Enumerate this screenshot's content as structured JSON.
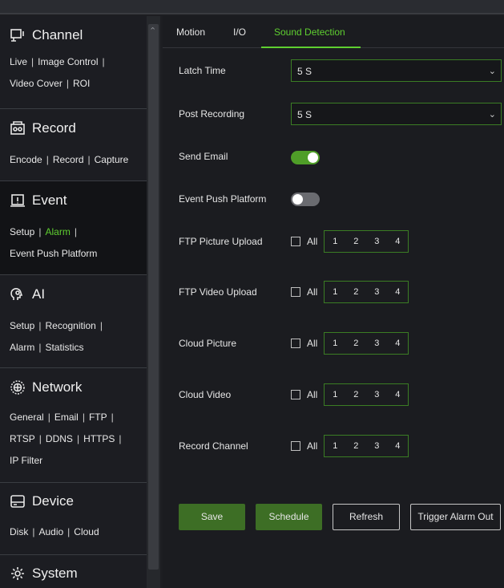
{
  "sidebar": {
    "sections": [
      {
        "title": "Channel",
        "links": [
          "Live",
          "Image Control",
          "Video Cover",
          "ROI"
        ]
      },
      {
        "title": "Record",
        "links": [
          "Encode",
          "Record",
          "Capture"
        ]
      },
      {
        "title": "Event",
        "links": [
          "Setup",
          "Alarm",
          "Event Push Platform"
        ],
        "active_link": "Alarm"
      },
      {
        "title": "AI",
        "links": [
          "Setup",
          "Recognition",
          "Alarm",
          "Statistics"
        ]
      },
      {
        "title": "Network",
        "links": [
          "General",
          "Email",
          "FTP",
          "RTSP",
          "DDNS",
          "HTTPS",
          "IP Filter"
        ]
      },
      {
        "title": "Device",
        "links": [
          "Disk",
          "Audio",
          "Cloud"
        ]
      },
      {
        "title": "System",
        "links": []
      }
    ]
  },
  "tabs": [
    "Motion",
    "I/O",
    "Sound Detection"
  ],
  "active_tab": "Sound Detection",
  "form": {
    "latch_time": {
      "label": "Latch Time",
      "value": "5 S"
    },
    "post_recording": {
      "label": "Post Recording",
      "value": "5 S"
    },
    "send_email": {
      "label": "Send Email",
      "on": true
    },
    "event_push": {
      "label": "Event Push Platform",
      "on": false
    },
    "channel_rows": [
      {
        "label": "FTP Picture Upload"
      },
      {
        "label": "FTP Video Upload"
      },
      {
        "label": "Cloud Picture"
      },
      {
        "label": "Cloud Video"
      },
      {
        "label": "Record Channel"
      }
    ],
    "all_label": "All",
    "channels": [
      "1",
      "2",
      "3",
      "4"
    ]
  },
  "buttons": {
    "save": "Save",
    "schedule": "Schedule",
    "refresh": "Refresh",
    "trigger": "Trigger Alarm Out"
  },
  "colors": {
    "accent": "#5fcf30",
    "button_green": "#3d6e25",
    "background": "#1b1c20"
  }
}
